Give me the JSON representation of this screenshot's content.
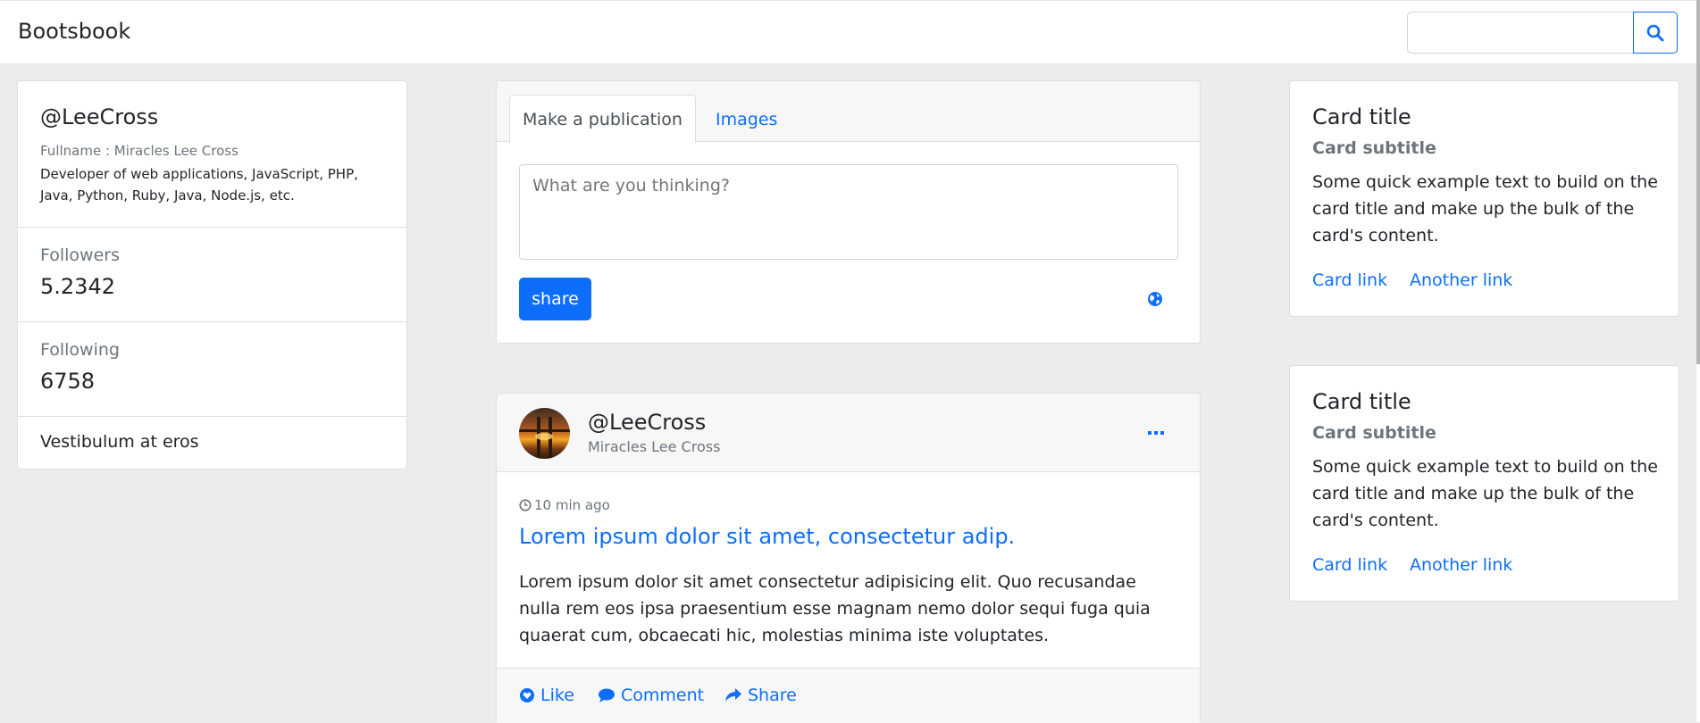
{
  "navbar": {
    "brand": "Bootsbook",
    "search": {
      "placeholder": "",
      "button_icon": "search-icon"
    }
  },
  "profile": {
    "username": "@LeeCross",
    "fullname": "Fullname : Miracles Lee Cross",
    "bio": "Developer of web applications, JavaScript, PHP, Java, Python, Ruby, Java, Node.js, etc.",
    "followers_label": "Followers",
    "followers_value": "5.2342",
    "following_label": "Following",
    "following_value": "6758",
    "extra": "Vestibulum at eros"
  },
  "publish": {
    "tabs": [
      "Make a publication",
      "Images"
    ],
    "active_tab": "Make a publication",
    "placeholder": "What are you thinking?",
    "share_label": "share",
    "visibility_icon": "globe-icon"
  },
  "post": {
    "username": "@LeeCross",
    "name": "Miracles Lee Cross",
    "menu_icon": "more-dots-icon",
    "time": "10 min ago",
    "title": "Lorem ipsum dolor sit amet, consectetur adip.",
    "body": "Lorem ipsum dolor sit amet consectetur adipisicing elit. Quo recusandae nulla rem eos ipsa praesentium esse magnam nemo dolor sequi fuga quia quaerat cum, obcaecati hic, molestias minima iste voluptates.",
    "actions": {
      "like": "Like",
      "comment": "Comment",
      "share": "Share"
    }
  },
  "side_cards": [
    {
      "title": "Card title",
      "subtitle": "Card subtitle",
      "text": "Some quick example text to build on the card title and make up the bulk of the card's content.",
      "link1": "Card link",
      "link2": "Another link"
    },
    {
      "title": "Card title",
      "subtitle": "Card subtitle",
      "text": "Some quick example text to build on the card title and make up the bulk of the card's content.",
      "link1": "Card link",
      "link2": "Another link"
    }
  ],
  "colors": {
    "primary": "#0d6efd",
    "background": "#ececec",
    "muted": "#6c757d"
  }
}
